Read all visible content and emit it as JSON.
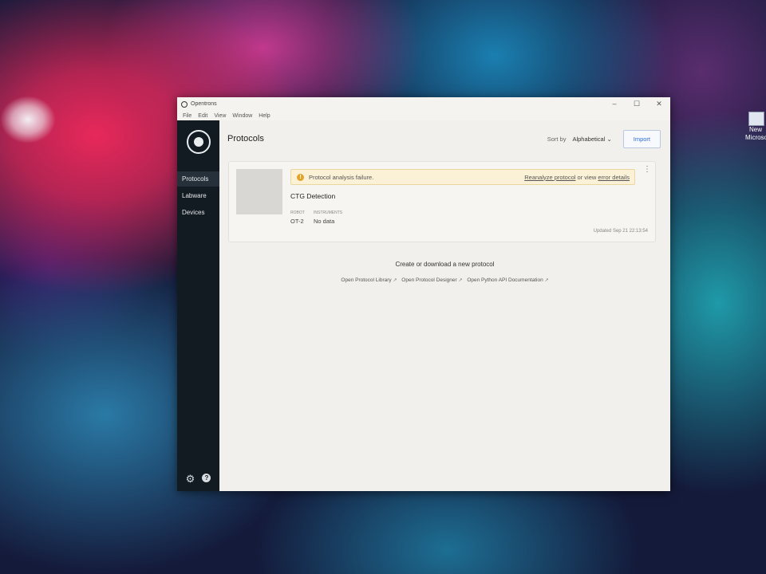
{
  "desktop": {
    "icon_label_1": "New",
    "icon_label_2": "Microso"
  },
  "window": {
    "title": "Opentrons",
    "controls": {
      "minimize": "–",
      "maximize": "☐",
      "close": "✕"
    },
    "menu": [
      "File",
      "Edit",
      "View",
      "Window",
      "Help"
    ]
  },
  "sidebar": {
    "items": [
      {
        "label": "Protocols",
        "active": true
      },
      {
        "label": "Labware",
        "active": false
      },
      {
        "label": "Devices",
        "active": false
      }
    ],
    "icons": [
      "gear-icon",
      "help-icon"
    ],
    "help_glyph": "?"
  },
  "header": {
    "title": "Protocols",
    "sort_label": "Sort by",
    "sort_value": "Alphabetical",
    "import_label": "Import"
  },
  "protocol_card": {
    "warning": {
      "message": "Protocol analysis failure.",
      "reanalyze_link": "Reanalyze protocol",
      "middle_text": " or view ",
      "details_link": "error details"
    },
    "name": "CTG Detection",
    "robot_label": "ROBOT",
    "instruments_label": "INSTRUMENTS",
    "robot_value": "OT-2",
    "instruments_value": "No data",
    "updated": "Updated Sep 21 22:13:54"
  },
  "empty_section": {
    "title": "Create or download a new protocol",
    "links": [
      "Open Protocol Library",
      "Open Protocol Designer",
      "Open Python API Documentation"
    ]
  },
  "colors": {
    "sidebar": "#121a22",
    "accent": "#2e6ed6",
    "warning": "#e2a42a"
  }
}
